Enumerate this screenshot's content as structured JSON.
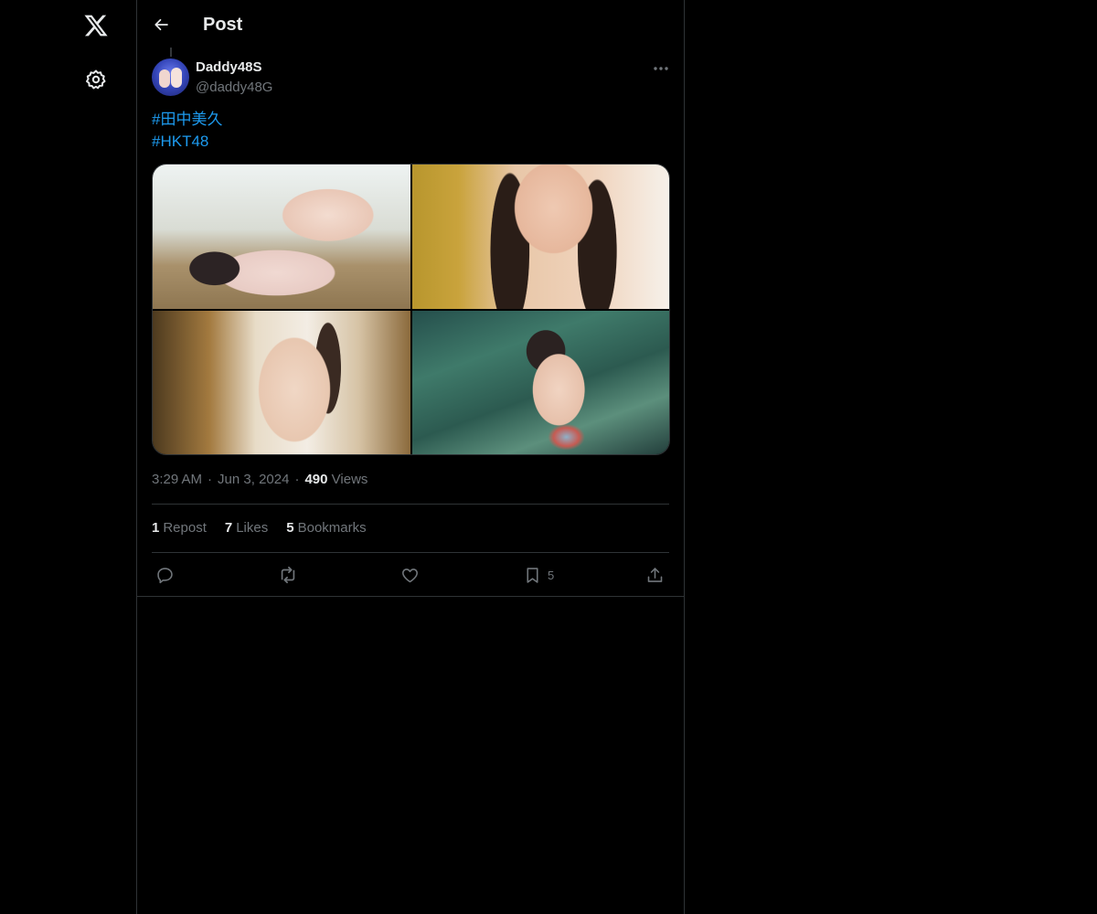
{
  "header": {
    "title": "Post"
  },
  "post": {
    "author": {
      "display_name": "Daddy48S",
      "handle": "@daddy48G"
    },
    "hashtags": [
      "#田中美久",
      "#HKT48"
    ],
    "time": "3:29 AM",
    "date": "Jun 3, 2024",
    "views_count": "490",
    "views_label": "Views",
    "separator": "·"
  },
  "stats": {
    "reposts": {
      "count": "1",
      "label": "Repost"
    },
    "likes": {
      "count": "7",
      "label": "Likes"
    },
    "bookmarks": {
      "count": "5",
      "label": "Bookmarks"
    }
  },
  "actions": {
    "bookmark_count": "5"
  },
  "icons": {
    "logo": "x-logo-icon",
    "settings": "gear-icon",
    "back": "arrow-left-icon",
    "more": "more-horizontal-icon",
    "reply": "reply-icon",
    "repost": "repost-icon",
    "like": "heart-icon",
    "bookmark": "bookmark-icon",
    "share": "share-icon"
  },
  "colors": {
    "accent": "#1d9bf0",
    "text": "#e7e9ea",
    "muted": "#71767b",
    "border": "#2f3336",
    "background": "#000000"
  }
}
